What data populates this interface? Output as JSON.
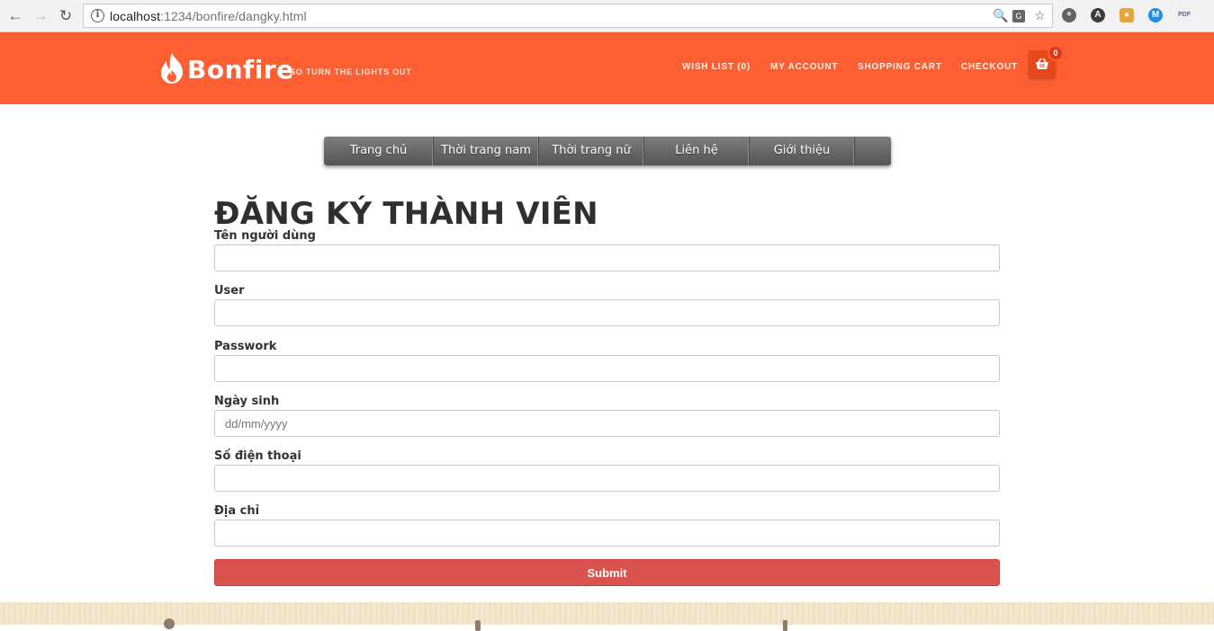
{
  "browser": {
    "url_host": "localhost",
    "url_rest": ":1234/bonfire/dangky.html"
  },
  "header": {
    "brand": "Bonfire",
    "tagline": "SO TURN THE LIGHTS OUT",
    "links": [
      "WISH LIST (0)",
      "MY ACCOUNT",
      "SHOPPING CART",
      "CHECKOUT"
    ],
    "cart_count": "0",
    "brand_color": "#fd5f33"
  },
  "nav": {
    "items": [
      "Trang chủ",
      "Thời trang nam",
      "Thời trang nữ",
      "Liên hệ",
      "Giới thiệu"
    ]
  },
  "form": {
    "title": "ĐĂNG KÝ THÀNH VIÊN",
    "fields": [
      {
        "label": "Tên người dùng",
        "placeholder": ""
      },
      {
        "label": "User",
        "placeholder": ""
      },
      {
        "label": "Passwork",
        "placeholder": ""
      },
      {
        "label": "Ngày sinh",
        "placeholder": "dd/mm/yyyy"
      },
      {
        "label": "Số điện thoại",
        "placeholder": ""
      },
      {
        "label": "Địa chỉ",
        "placeholder": ""
      }
    ],
    "submit_label": "Submit",
    "submit_color": "#d9534f"
  }
}
